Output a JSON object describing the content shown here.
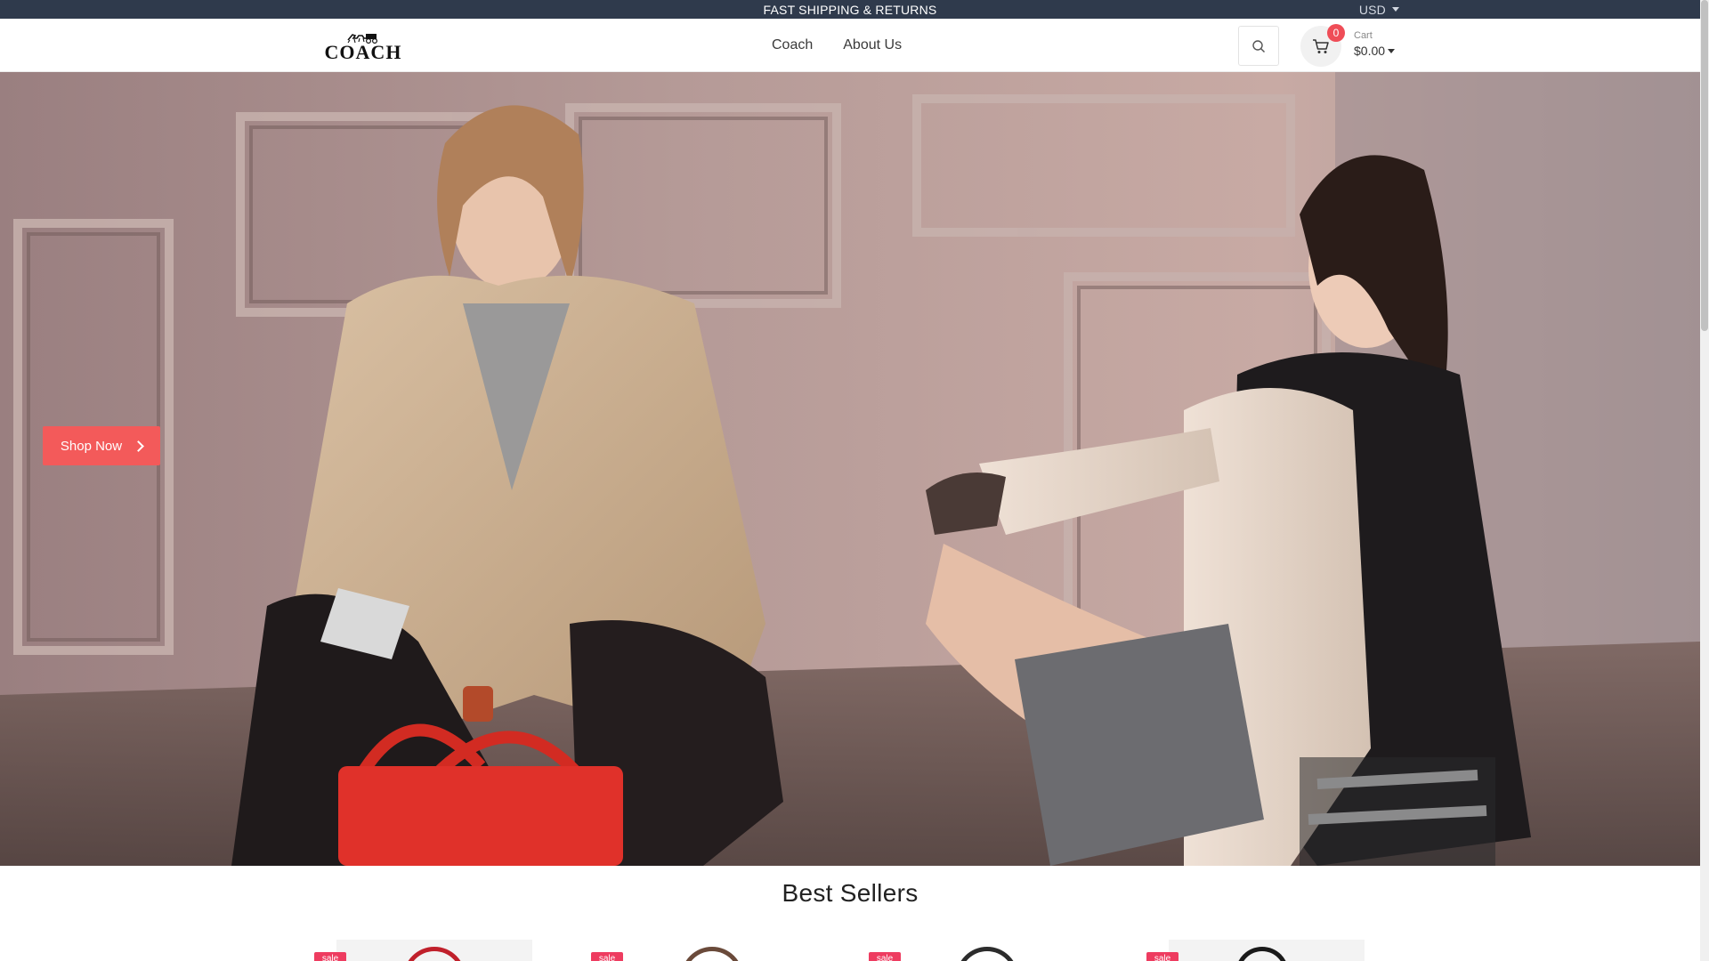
{
  "topbar": {
    "announcement": "FAST SHIPPING & RETURNS",
    "currency": "USD"
  },
  "header": {
    "logo_text": "COACH",
    "nav": [
      {
        "label": "Coach"
      },
      {
        "label": "About Us"
      }
    ],
    "cart": {
      "count": "0",
      "label": "Cart",
      "total": "$0.00"
    }
  },
  "hero": {
    "cta_label": "Shop Now"
  },
  "best_sellers": {
    "title": "Best Sellers",
    "products": [
      {
        "badge": "sale"
      },
      {
        "badge": "sale"
      },
      {
        "badge": "sale"
      },
      {
        "badge": "sale"
      }
    ]
  },
  "colors": {
    "topbar_bg": "#2f3a4c",
    "accent": "#f35a5a",
    "sale_badge": "#ee3c60",
    "cart_badge": "#ef4d57"
  },
  "icons": {
    "search": "search-icon",
    "cart": "cart-icon",
    "cta_arrow": "chevron-right-icon"
  }
}
